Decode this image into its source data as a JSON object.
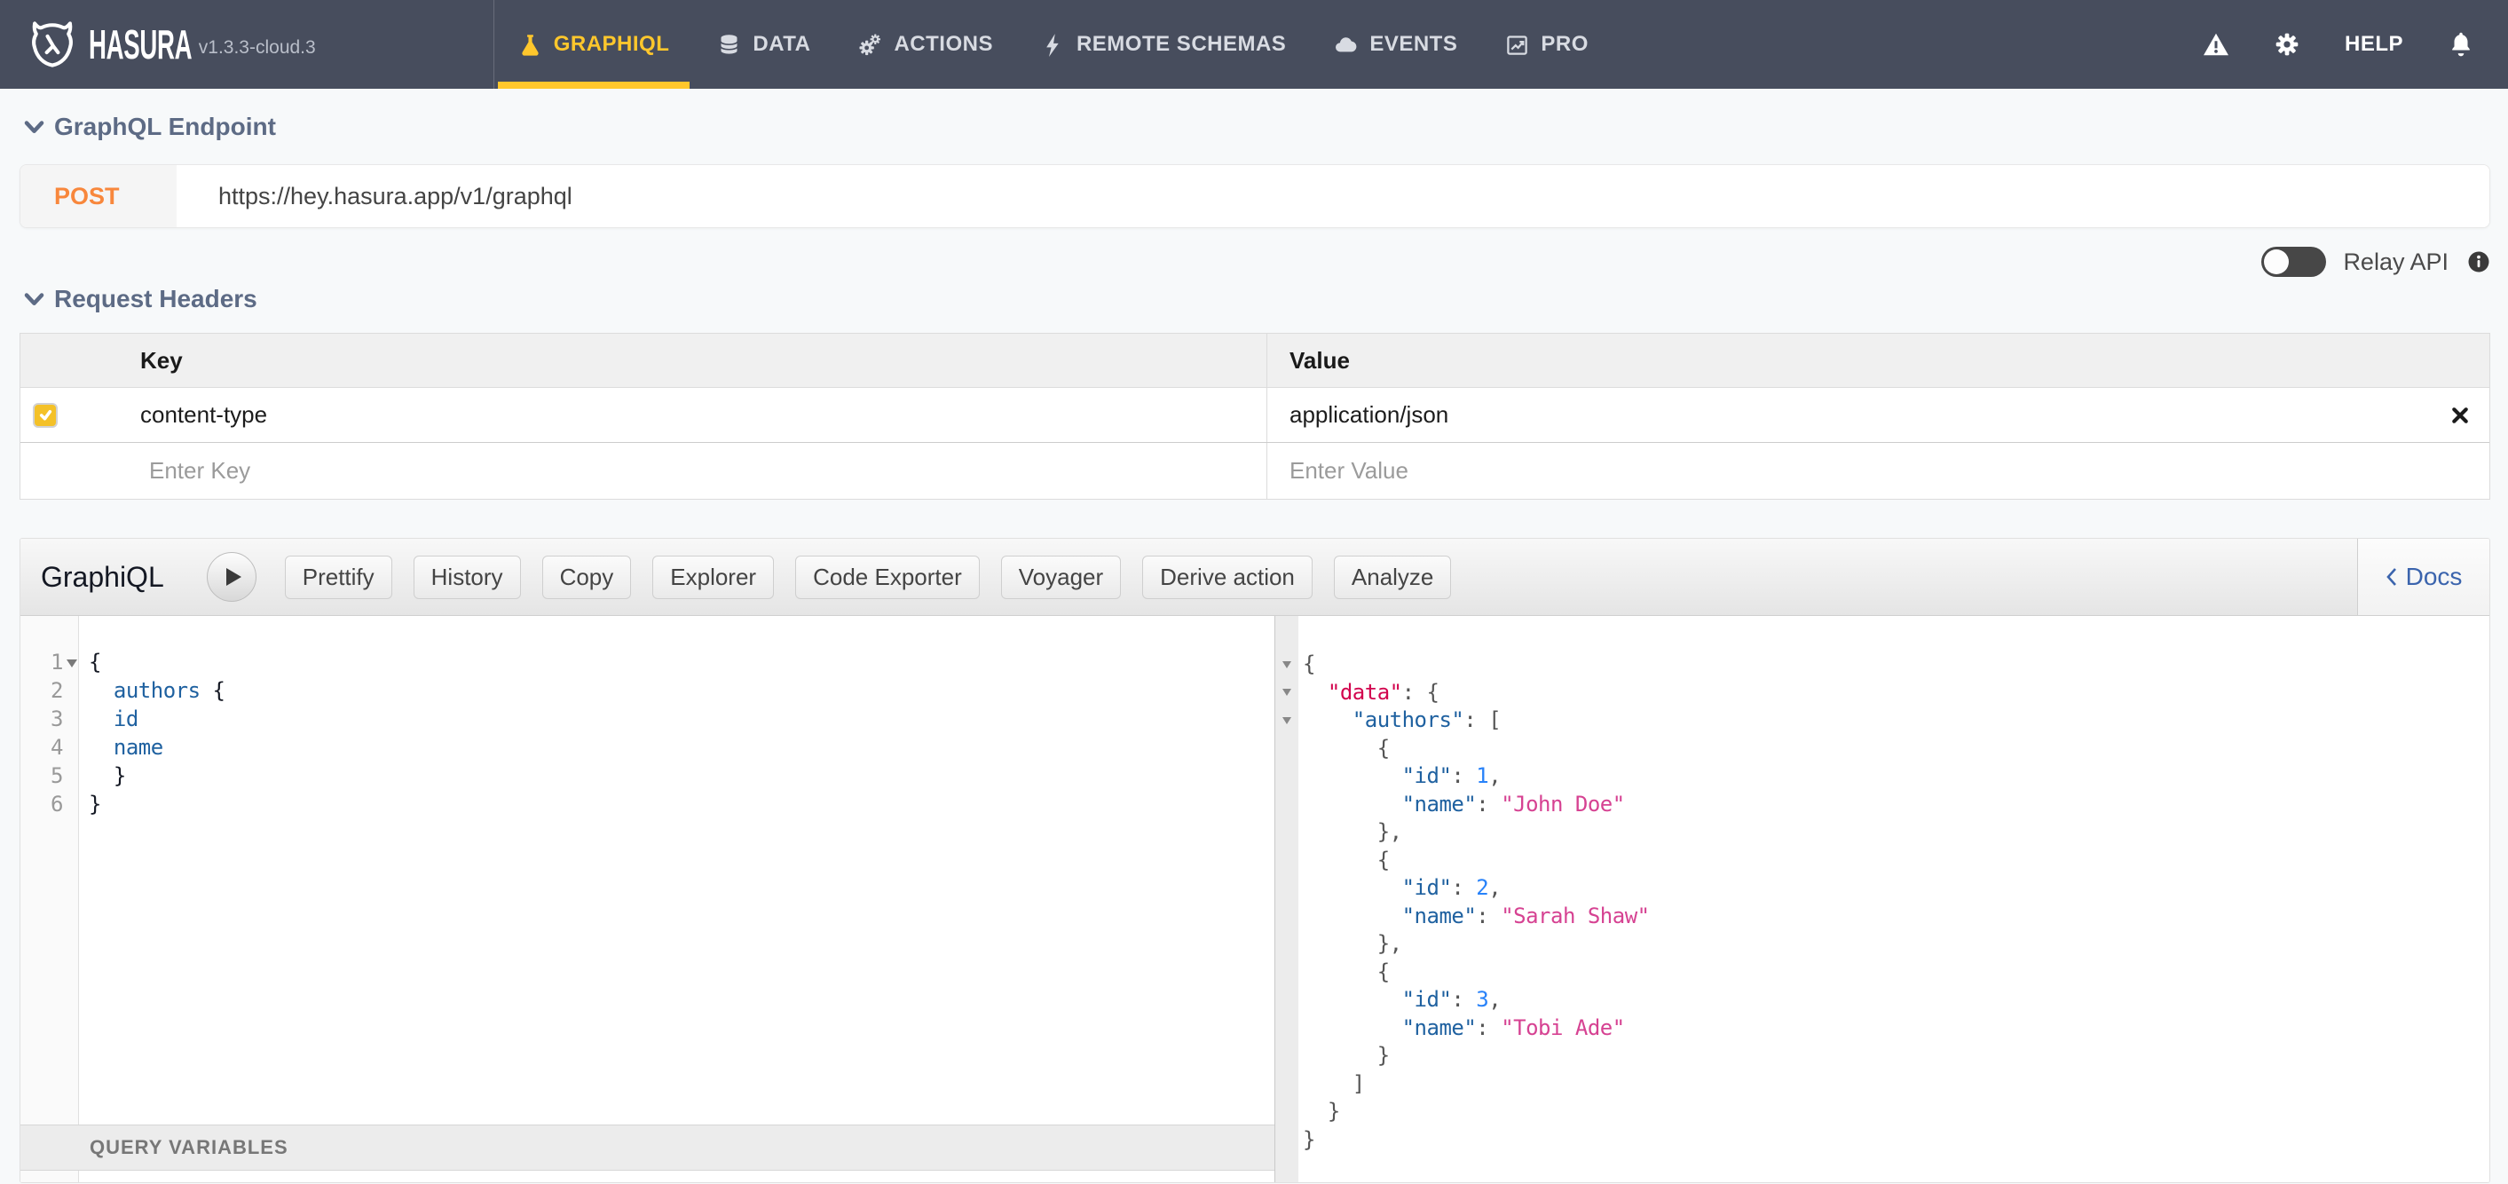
{
  "colors": {
    "nav_bg": "#474d5d",
    "accent_yellow": "#ffc72c",
    "orange": "#f8873c",
    "heading": "#5d6b85",
    "docs_blue": "#3b64ad",
    "toggle": "#474747",
    "checkbox": "#f4c128",
    "tok_property": "#1f61a0",
    "tok_def": "#d2054e",
    "tok_string": "#d64292",
    "tok_number": "#2882f9"
  },
  "nav": {
    "brand": "HASURA",
    "version": "v1.3.3-cloud.3",
    "items": [
      {
        "label": "GRAPHIQL",
        "icon": "flask-icon",
        "active": true
      },
      {
        "label": "DATA",
        "icon": "database-icon",
        "active": false
      },
      {
        "label": "ACTIONS",
        "icon": "gears-icon",
        "active": false
      },
      {
        "label": "REMOTE SCHEMAS",
        "icon": "plug-icon",
        "active": false
      },
      {
        "label": "EVENTS",
        "icon": "cloud-icon",
        "active": false
      },
      {
        "label": "PRO",
        "icon": "chart-icon",
        "active": false
      }
    ],
    "right": {
      "help_label": "HELP",
      "icons": [
        "warning-icon",
        "settings-icon",
        "notifications-icon"
      ]
    }
  },
  "endpoint": {
    "section_title": "GraphQL Endpoint",
    "method": "POST",
    "url": "https://hey.hasura.app/v1/graphql",
    "relay_label": "Relay API"
  },
  "headers": {
    "section_title": "Request Headers",
    "columns": {
      "key": "Key",
      "value": "Value"
    },
    "rows": [
      {
        "key": "content-type",
        "value": "application/json",
        "checked": true
      }
    ],
    "key_placeholder": "Enter Key",
    "value_placeholder": "Enter Value"
  },
  "graphiql": {
    "title": "GraphiQL",
    "buttons": [
      "Prettify",
      "History",
      "Copy",
      "Explorer",
      "Code Exporter",
      "Voyager",
      "Derive action",
      "Analyze"
    ],
    "docs_label": "Docs",
    "variables_label": "QUERY VARIABLES",
    "query_folds": [
      1
    ],
    "response_folds": [
      1,
      2,
      3
    ],
    "query_lines": [
      [
        [
          "t",
          "{"
        ]
      ],
      [
        [
          "t",
          "  "
        ],
        [
          "k",
          "authors"
        ],
        [
          "t",
          " {"
        ]
      ],
      [
        [
          "t",
          "  "
        ],
        [
          "k",
          "id"
        ]
      ],
      [
        [
          "t",
          "  "
        ],
        [
          "k",
          "name"
        ]
      ],
      [
        [
          "t",
          "  }"
        ]
      ],
      [
        [
          "t",
          "}"
        ]
      ]
    ],
    "response_lines": [
      [
        [
          "t",
          "{"
        ]
      ],
      [
        [
          "t",
          "  "
        ],
        [
          "d",
          "\"data\""
        ],
        [
          "t",
          ": {"
        ]
      ],
      [
        [
          "t",
          "    "
        ],
        [
          "k",
          "\"authors\""
        ],
        [
          "t",
          ": ["
        ]
      ],
      [
        [
          "t",
          "      {"
        ]
      ],
      [
        [
          "t",
          "        "
        ],
        [
          "k",
          "\"id\""
        ],
        [
          "t",
          ": "
        ],
        [
          "n",
          "1"
        ],
        [
          "t",
          ","
        ]
      ],
      [
        [
          "t",
          "        "
        ],
        [
          "k",
          "\"name\""
        ],
        [
          "t",
          ": "
        ],
        [
          "s",
          "\"John Doe\""
        ]
      ],
      [
        [
          "t",
          "      },"
        ]
      ],
      [
        [
          "t",
          "      {"
        ]
      ],
      [
        [
          "t",
          "        "
        ],
        [
          "k",
          "\"id\""
        ],
        [
          "t",
          ": "
        ],
        [
          "n",
          "2"
        ],
        [
          "t",
          ","
        ]
      ],
      [
        [
          "t",
          "        "
        ],
        [
          "k",
          "\"name\""
        ],
        [
          "t",
          ": "
        ],
        [
          "s",
          "\"Sarah Shaw\""
        ]
      ],
      [
        [
          "t",
          "      },"
        ]
      ],
      [
        [
          "t",
          "      {"
        ]
      ],
      [
        [
          "t",
          "        "
        ],
        [
          "k",
          "\"id\""
        ],
        [
          "t",
          ": "
        ],
        [
          "n",
          "3"
        ],
        [
          "t",
          ","
        ]
      ],
      [
        [
          "t",
          "        "
        ],
        [
          "k",
          "\"name\""
        ],
        [
          "t",
          ": "
        ],
        [
          "s",
          "\"Tobi Ade\""
        ]
      ],
      [
        [
          "t",
          "      }"
        ]
      ],
      [
        [
          "t",
          "    ]"
        ]
      ],
      [
        [
          "t",
          "  }"
        ]
      ],
      [
        [
          "t",
          "}"
        ]
      ]
    ]
  }
}
